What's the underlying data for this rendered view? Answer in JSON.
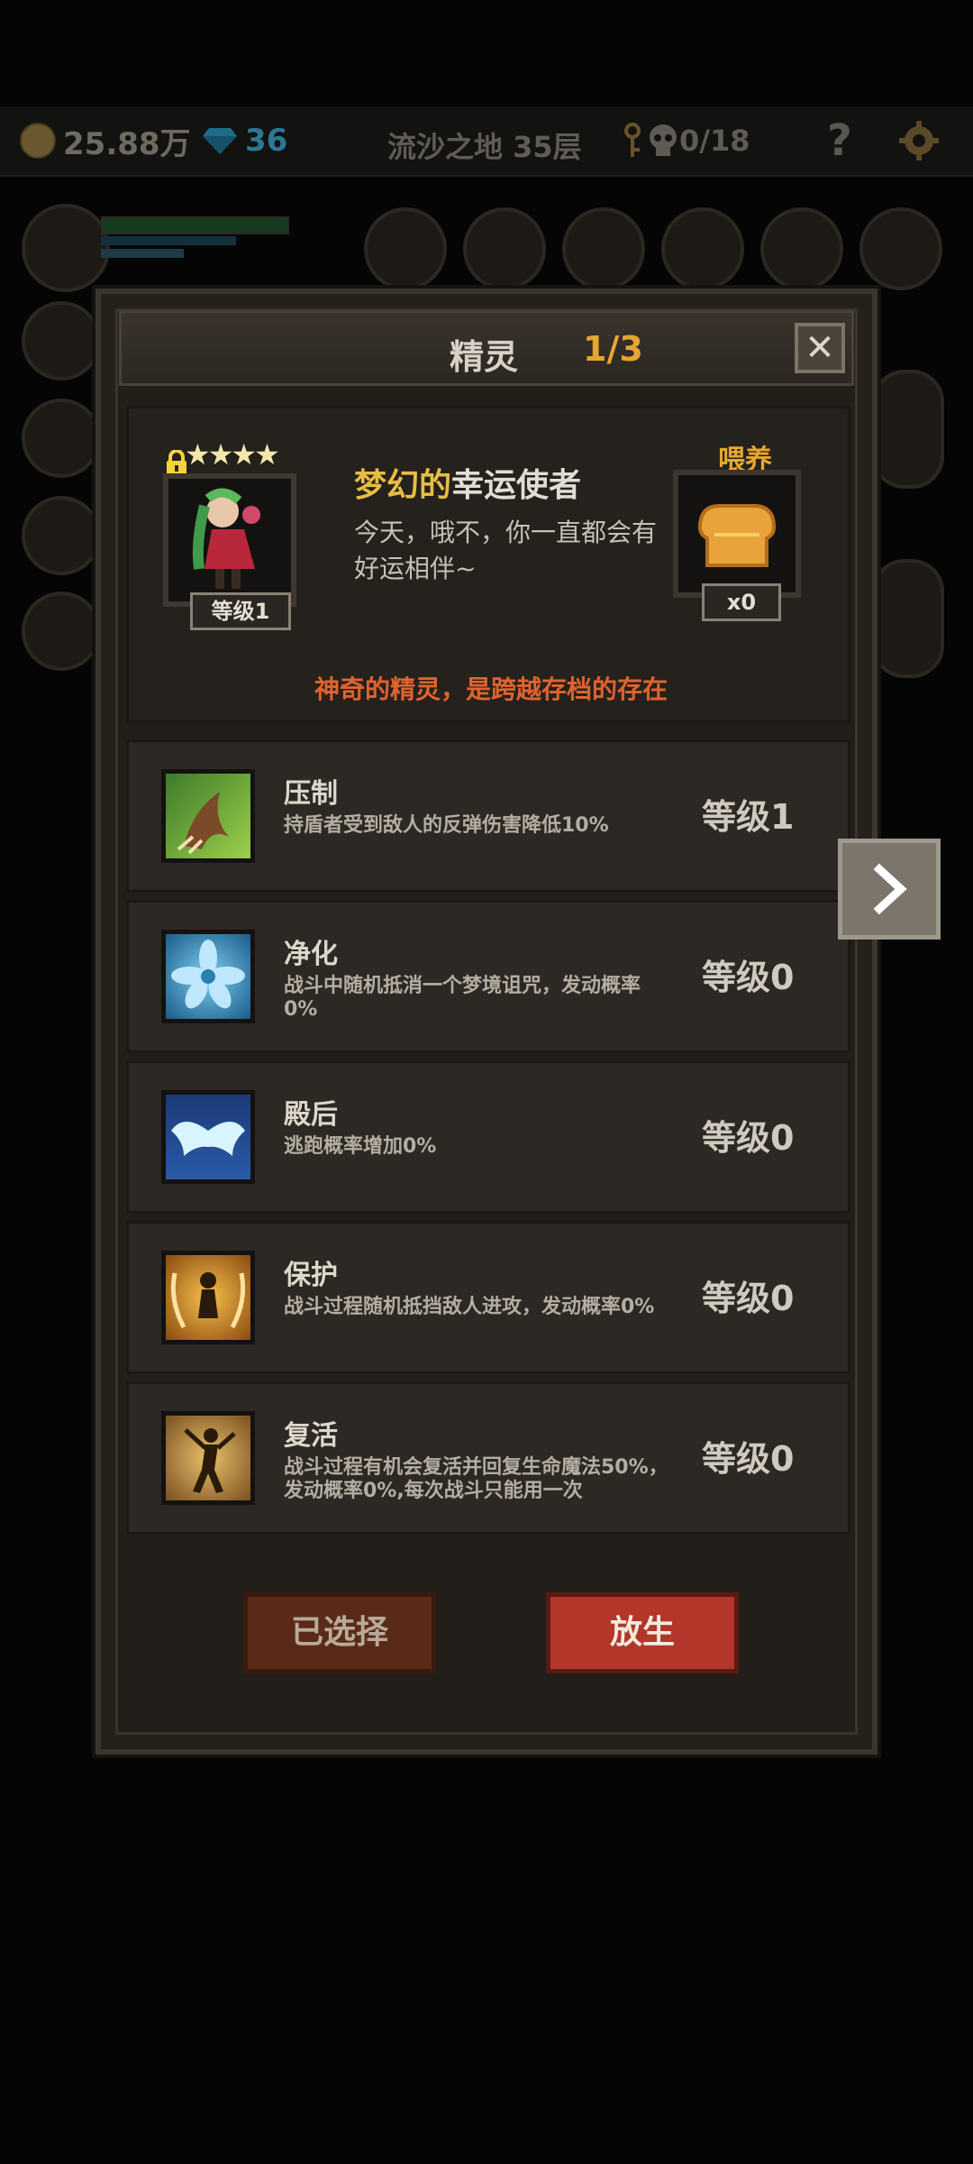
{
  "topbar": {
    "gold": "25.88万",
    "gems": "36",
    "floor": "流沙之地 35层",
    "keys_skulls": "0/18",
    "help": "?"
  },
  "dialog": {
    "title": "精灵",
    "page": "1/3",
    "close": "✕"
  },
  "spirit": {
    "stars": "★★★★",
    "level": "等级1",
    "name_part1": "梦幻的",
    "name_part2": "幸运使者",
    "desc": "今天，哦不，你一直都会有好运相伴~",
    "feed_label": "喂养",
    "feed_count": "x0",
    "tagline": "神奇的精灵，是跨越存档的存在"
  },
  "skills": [
    {
      "name": "压制",
      "desc": "持盾者受到敌人的反弹伤害降低10%",
      "level": "等级1",
      "icon": "claw-icon"
    },
    {
      "name": "净化",
      "desc": "战斗中随机抵消一个梦境诅咒，发动概率0%",
      "level": "等级0",
      "icon": "blue-flower-icon"
    },
    {
      "name": "殿后",
      "desc": "逃跑概率增加0%",
      "level": "等级0",
      "icon": "wings-icon"
    },
    {
      "name": "保护",
      "desc": "战斗过程随机抵挡敌人进攻，发动概率0%",
      "level": "等级0",
      "icon": "guardian-icon"
    },
    {
      "name": "复活",
      "desc": "战斗过程有机会复活并回复生命魔法50%，发动概率0%,每次战斗只能用一次",
      "level": "等级0",
      "icon": "revive-icon"
    }
  ],
  "buttons": {
    "selected": "已选择",
    "release": "放生"
  },
  "colors": {
    "accent_gold": "#e6a630",
    "tagline_orange": "#e0632f",
    "release_red": "#b3362a"
  }
}
